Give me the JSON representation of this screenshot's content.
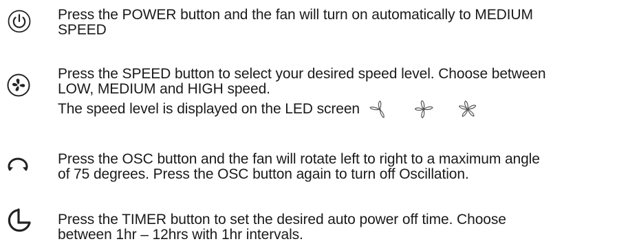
{
  "instructions": [
    {
      "icon": "power-icon",
      "lines": [
        "Press the POWER button and the fan will turn on automatically to MEDIUM",
        "SPEED"
      ]
    },
    {
      "icon": "fan-speed-icon",
      "lines": [
        "Press the SPEED button to select your desired speed level. Choose between",
        "LOW, MEDIUM and HIGH speed."
      ],
      "extra_line": "The speed level is displayed on the LED screen",
      "speed_indicators": [
        "low-speed-fan-icon",
        "medium-speed-fan-icon",
        "high-speed-fan-icon"
      ]
    },
    {
      "icon": "oscillation-icon",
      "lines": [
        "Press the OSC button and the fan will rotate left to right to a maximum angle",
        "of 75 degrees. Press the OSC button again to turn off Oscillation."
      ]
    },
    {
      "icon": "timer-icon",
      "lines": [
        "Press the TIMER button to set the desired auto power off time. Choose",
        "between 1hr – 12hrs with 1hr intervals."
      ]
    }
  ]
}
